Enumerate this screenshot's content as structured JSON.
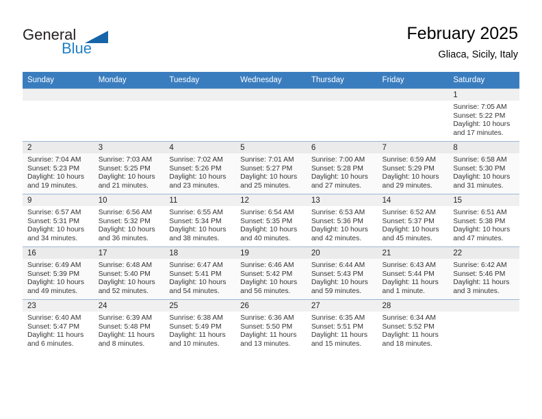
{
  "logo": {
    "word_top": "General",
    "word_bottom": "Blue",
    "triangle_icon": "triangle-icon",
    "color_dark": "#231f20",
    "color_blue": "#1f7fc4"
  },
  "header": {
    "title": "February 2025",
    "subtitle": "Gliaca, Sicily, Italy"
  },
  "theme": {
    "header_row_bg": "#3a7dbf",
    "header_row_text": "#ffffff",
    "daynum_bar_bg": "#f0f0f0",
    "row_border": "#9ab7d3"
  },
  "weekday_headers": [
    "Sunday",
    "Monday",
    "Tuesday",
    "Wednesday",
    "Thursday",
    "Friday",
    "Saturday"
  ],
  "weeks": [
    {
      "shaded": false,
      "days": [
        {
          "day": "",
          "lines": []
        },
        {
          "day": "",
          "lines": []
        },
        {
          "day": "",
          "lines": []
        },
        {
          "day": "",
          "lines": []
        },
        {
          "day": "",
          "lines": []
        },
        {
          "day": "",
          "lines": []
        },
        {
          "day": "1",
          "lines": [
            "Sunrise: 7:05 AM",
            "Sunset: 5:22 PM",
            "Daylight: 10 hours",
            "and 17 minutes."
          ]
        }
      ]
    },
    {
      "shaded": true,
      "days": [
        {
          "day": "2",
          "lines": [
            "Sunrise: 7:04 AM",
            "Sunset: 5:23 PM",
            "Daylight: 10 hours",
            "and 19 minutes."
          ]
        },
        {
          "day": "3",
          "lines": [
            "Sunrise: 7:03 AM",
            "Sunset: 5:25 PM",
            "Daylight: 10 hours",
            "and 21 minutes."
          ]
        },
        {
          "day": "4",
          "lines": [
            "Sunrise: 7:02 AM",
            "Sunset: 5:26 PM",
            "Daylight: 10 hours",
            "and 23 minutes."
          ]
        },
        {
          "day": "5",
          "lines": [
            "Sunrise: 7:01 AM",
            "Sunset: 5:27 PM",
            "Daylight: 10 hours",
            "and 25 minutes."
          ]
        },
        {
          "day": "6",
          "lines": [
            "Sunrise: 7:00 AM",
            "Sunset: 5:28 PM",
            "Daylight: 10 hours",
            "and 27 minutes."
          ]
        },
        {
          "day": "7",
          "lines": [
            "Sunrise: 6:59 AM",
            "Sunset: 5:29 PM",
            "Daylight: 10 hours",
            "and 29 minutes."
          ]
        },
        {
          "day": "8",
          "lines": [
            "Sunrise: 6:58 AM",
            "Sunset: 5:30 PM",
            "Daylight: 10 hours",
            "and 31 minutes."
          ]
        }
      ]
    },
    {
      "shaded": false,
      "days": [
        {
          "day": "9",
          "lines": [
            "Sunrise: 6:57 AM",
            "Sunset: 5:31 PM",
            "Daylight: 10 hours",
            "and 34 minutes."
          ]
        },
        {
          "day": "10",
          "lines": [
            "Sunrise: 6:56 AM",
            "Sunset: 5:32 PM",
            "Daylight: 10 hours",
            "and 36 minutes."
          ]
        },
        {
          "day": "11",
          "lines": [
            "Sunrise: 6:55 AM",
            "Sunset: 5:34 PM",
            "Daylight: 10 hours",
            "and 38 minutes."
          ]
        },
        {
          "day": "12",
          "lines": [
            "Sunrise: 6:54 AM",
            "Sunset: 5:35 PM",
            "Daylight: 10 hours",
            "and 40 minutes."
          ]
        },
        {
          "day": "13",
          "lines": [
            "Sunrise: 6:53 AM",
            "Sunset: 5:36 PM",
            "Daylight: 10 hours",
            "and 42 minutes."
          ]
        },
        {
          "day": "14",
          "lines": [
            "Sunrise: 6:52 AM",
            "Sunset: 5:37 PM",
            "Daylight: 10 hours",
            "and 45 minutes."
          ]
        },
        {
          "day": "15",
          "lines": [
            "Sunrise: 6:51 AM",
            "Sunset: 5:38 PM",
            "Daylight: 10 hours",
            "and 47 minutes."
          ]
        }
      ]
    },
    {
      "shaded": true,
      "days": [
        {
          "day": "16",
          "lines": [
            "Sunrise: 6:49 AM",
            "Sunset: 5:39 PM",
            "Daylight: 10 hours",
            "and 49 minutes."
          ]
        },
        {
          "day": "17",
          "lines": [
            "Sunrise: 6:48 AM",
            "Sunset: 5:40 PM",
            "Daylight: 10 hours",
            "and 52 minutes."
          ]
        },
        {
          "day": "18",
          "lines": [
            "Sunrise: 6:47 AM",
            "Sunset: 5:41 PM",
            "Daylight: 10 hours",
            "and 54 minutes."
          ]
        },
        {
          "day": "19",
          "lines": [
            "Sunrise: 6:46 AM",
            "Sunset: 5:42 PM",
            "Daylight: 10 hours",
            "and 56 minutes."
          ]
        },
        {
          "day": "20",
          "lines": [
            "Sunrise: 6:44 AM",
            "Sunset: 5:43 PM",
            "Daylight: 10 hours",
            "and 59 minutes."
          ]
        },
        {
          "day": "21",
          "lines": [
            "Sunrise: 6:43 AM",
            "Sunset: 5:44 PM",
            "Daylight: 11 hours",
            "and 1 minute."
          ]
        },
        {
          "day": "22",
          "lines": [
            "Sunrise: 6:42 AM",
            "Sunset: 5:46 PM",
            "Daylight: 11 hours",
            "and 3 minutes."
          ]
        }
      ]
    },
    {
      "shaded": false,
      "days": [
        {
          "day": "23",
          "lines": [
            "Sunrise: 6:40 AM",
            "Sunset: 5:47 PM",
            "Daylight: 11 hours",
            "and 6 minutes."
          ]
        },
        {
          "day": "24",
          "lines": [
            "Sunrise: 6:39 AM",
            "Sunset: 5:48 PM",
            "Daylight: 11 hours",
            "and 8 minutes."
          ]
        },
        {
          "day": "25",
          "lines": [
            "Sunrise: 6:38 AM",
            "Sunset: 5:49 PM",
            "Daylight: 11 hours",
            "and 10 minutes."
          ]
        },
        {
          "day": "26",
          "lines": [
            "Sunrise: 6:36 AM",
            "Sunset: 5:50 PM",
            "Daylight: 11 hours",
            "and 13 minutes."
          ]
        },
        {
          "day": "27",
          "lines": [
            "Sunrise: 6:35 AM",
            "Sunset: 5:51 PM",
            "Daylight: 11 hours",
            "and 15 minutes."
          ]
        },
        {
          "day": "28",
          "lines": [
            "Sunrise: 6:34 AM",
            "Sunset: 5:52 PM",
            "Daylight: 11 hours",
            "and 18 minutes."
          ]
        },
        {
          "day": "",
          "lines": []
        }
      ]
    }
  ]
}
